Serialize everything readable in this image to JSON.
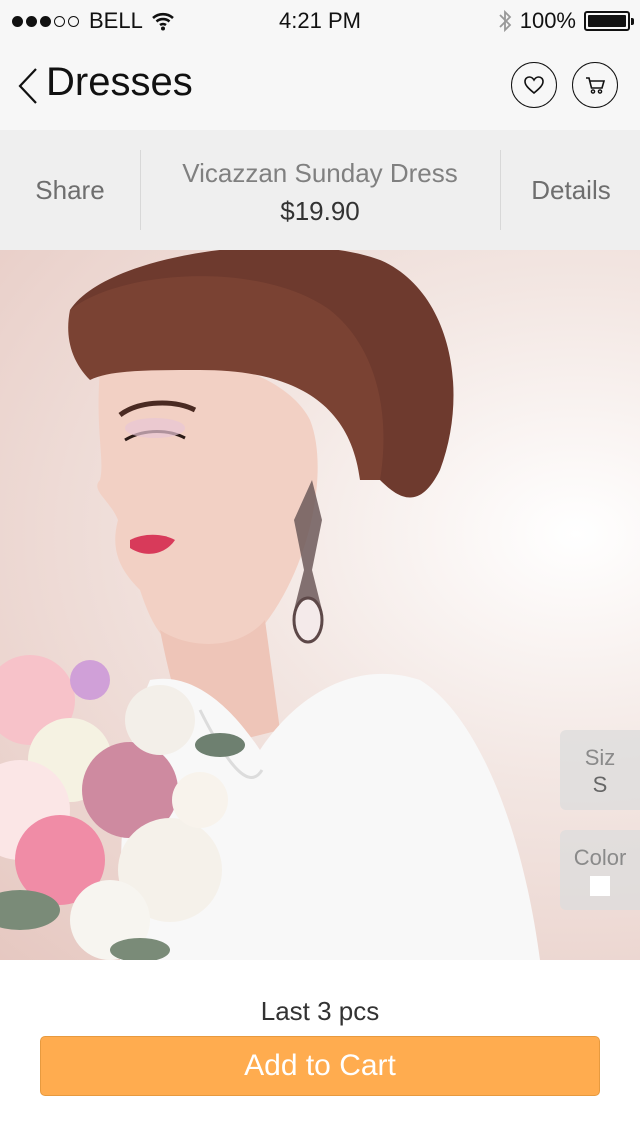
{
  "status_bar": {
    "carrier": "BELL",
    "time": "4:21 PM",
    "battery": "100%",
    "signal_total": 5,
    "signal_filled": 3
  },
  "nav": {
    "title": "Dresses",
    "back_icon": "chevron-left-icon",
    "favorite_icon": "heart-icon",
    "cart_icon": "cart-icon"
  },
  "product": {
    "share_label": "Share",
    "name": "Vicazzan Sunday Dress",
    "price": "$19.90",
    "details_label": "Details"
  },
  "options": {
    "size_label": "Siz",
    "size_value": "S",
    "color_label": "Color",
    "color_value": "#ffffff"
  },
  "stock_text": "Last 3 pcs",
  "add_to_cart_label": "Add to Cart",
  "colors": {
    "accent": "#ffac4f",
    "bar_background": "#efefef"
  }
}
